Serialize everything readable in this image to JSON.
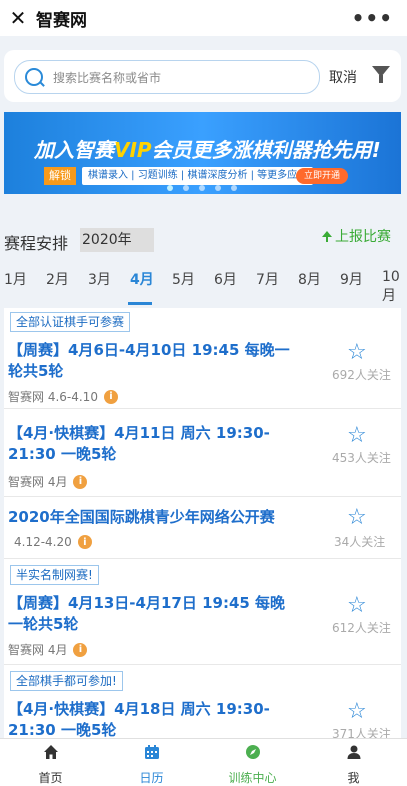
{
  "app": {
    "title": "智赛网",
    "close_glyph": "✕",
    "more_glyph": "•••"
  },
  "search": {
    "placeholder": "搜索比赛名称或省市",
    "cancel_label": "取消"
  },
  "banner": {
    "headline_pre": "加入智赛",
    "headline_vip": "VIP",
    "headline_post": "会员更多涨棋利器抢先用!",
    "tag": "解锁",
    "features": "棋谱录入 | 习题训练 | 棋谱深度分析 | 等更多应用",
    "open_label": "立即开通"
  },
  "schedule": {
    "title": "赛程安排",
    "year": "2020年",
    "report_label": "上报比赛"
  },
  "months": [
    "1月",
    "2月",
    "3月",
    "4月",
    "5月",
    "6月",
    "7月",
    "8月",
    "9月",
    "10月"
  ],
  "active_month": "4月",
  "events": [
    {
      "badge": "全部认证棋手可参赛",
      "title": "【周赛】4月6日-4月10日 19:45 每晚一轮共5轮",
      "meta": "智赛网  4.6-4.10",
      "followers": "692人关注"
    },
    {
      "badge": "",
      "title": "【4月·快棋赛】4月11日 周六 19:30-21:30 一晚5轮",
      "meta": "智赛网  4月",
      "followers": "453人关注"
    },
    {
      "badge": "",
      "title": "2020年全国国际跳棋青少年网络公开赛",
      "meta": "4.12-4.20",
      "followers": "34人关注"
    },
    {
      "badge": "半实名制网赛!",
      "title": "【周赛】4月13日-4月17日 19:45 每晚一轮共5轮",
      "meta": "智赛网  4月",
      "followers": "612人关注"
    },
    {
      "badge": "全部棋手都可参加!",
      "title": "【4月·快棋赛】4月18日 周六 19:30-21:30 一晚5轮",
      "meta": "",
      "followers": "371人关注"
    }
  ],
  "tabs": [
    {
      "label": "首页",
      "icon": "home-icon"
    },
    {
      "label": "日历",
      "icon": "calendar-icon"
    },
    {
      "label": "训练中心",
      "icon": "compass-icon"
    },
    {
      "label": "我",
      "icon": "user-icon"
    }
  ],
  "colors": {
    "accent": "#2a86d6",
    "green": "#3aab36",
    "info": "#f0a040"
  }
}
